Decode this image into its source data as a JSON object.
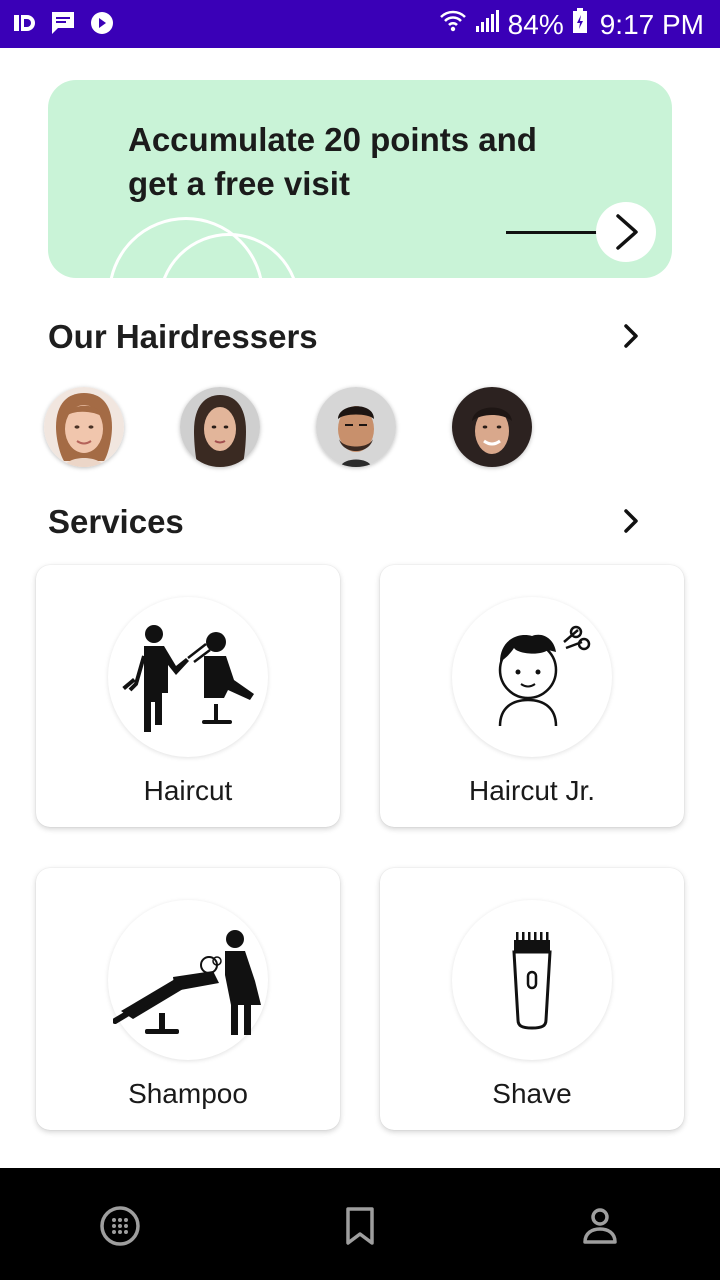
{
  "status_bar": {
    "battery": "84%",
    "time": "9:17 PM",
    "icons": [
      "id-icon",
      "message-icon",
      "play-icon",
      "wifi-icon",
      "signal-icon",
      "battery-icon"
    ]
  },
  "promo": {
    "text": "Accumulate 20 points and get a free visit",
    "icon": "arrow-right-icon"
  },
  "hairdressers": {
    "title": "Our Hairdressers",
    "icon": "chevron-right-icon",
    "avatars": [
      "avatar-1",
      "avatar-2",
      "avatar-3",
      "avatar-4"
    ]
  },
  "services": {
    "title": "Services",
    "icon": "chevron-right-icon",
    "items": [
      {
        "label": "Haircut",
        "icon": "haircut-icon"
      },
      {
        "label": "Haircut Jr.",
        "icon": "kid-haircut-icon"
      },
      {
        "label": "Shampoo",
        "icon": "shampoo-icon"
      },
      {
        "label": "Shave",
        "icon": "shaver-icon"
      }
    ]
  },
  "bottom_nav": {
    "items": [
      "grid-icon",
      "bookmark-icon",
      "person-icon"
    ]
  },
  "colors": {
    "status_bar": "#3a00b7",
    "promo_bg": "#c9f3d7",
    "nav_bg": "#000000",
    "nav_icon": "#9e9e9e"
  }
}
